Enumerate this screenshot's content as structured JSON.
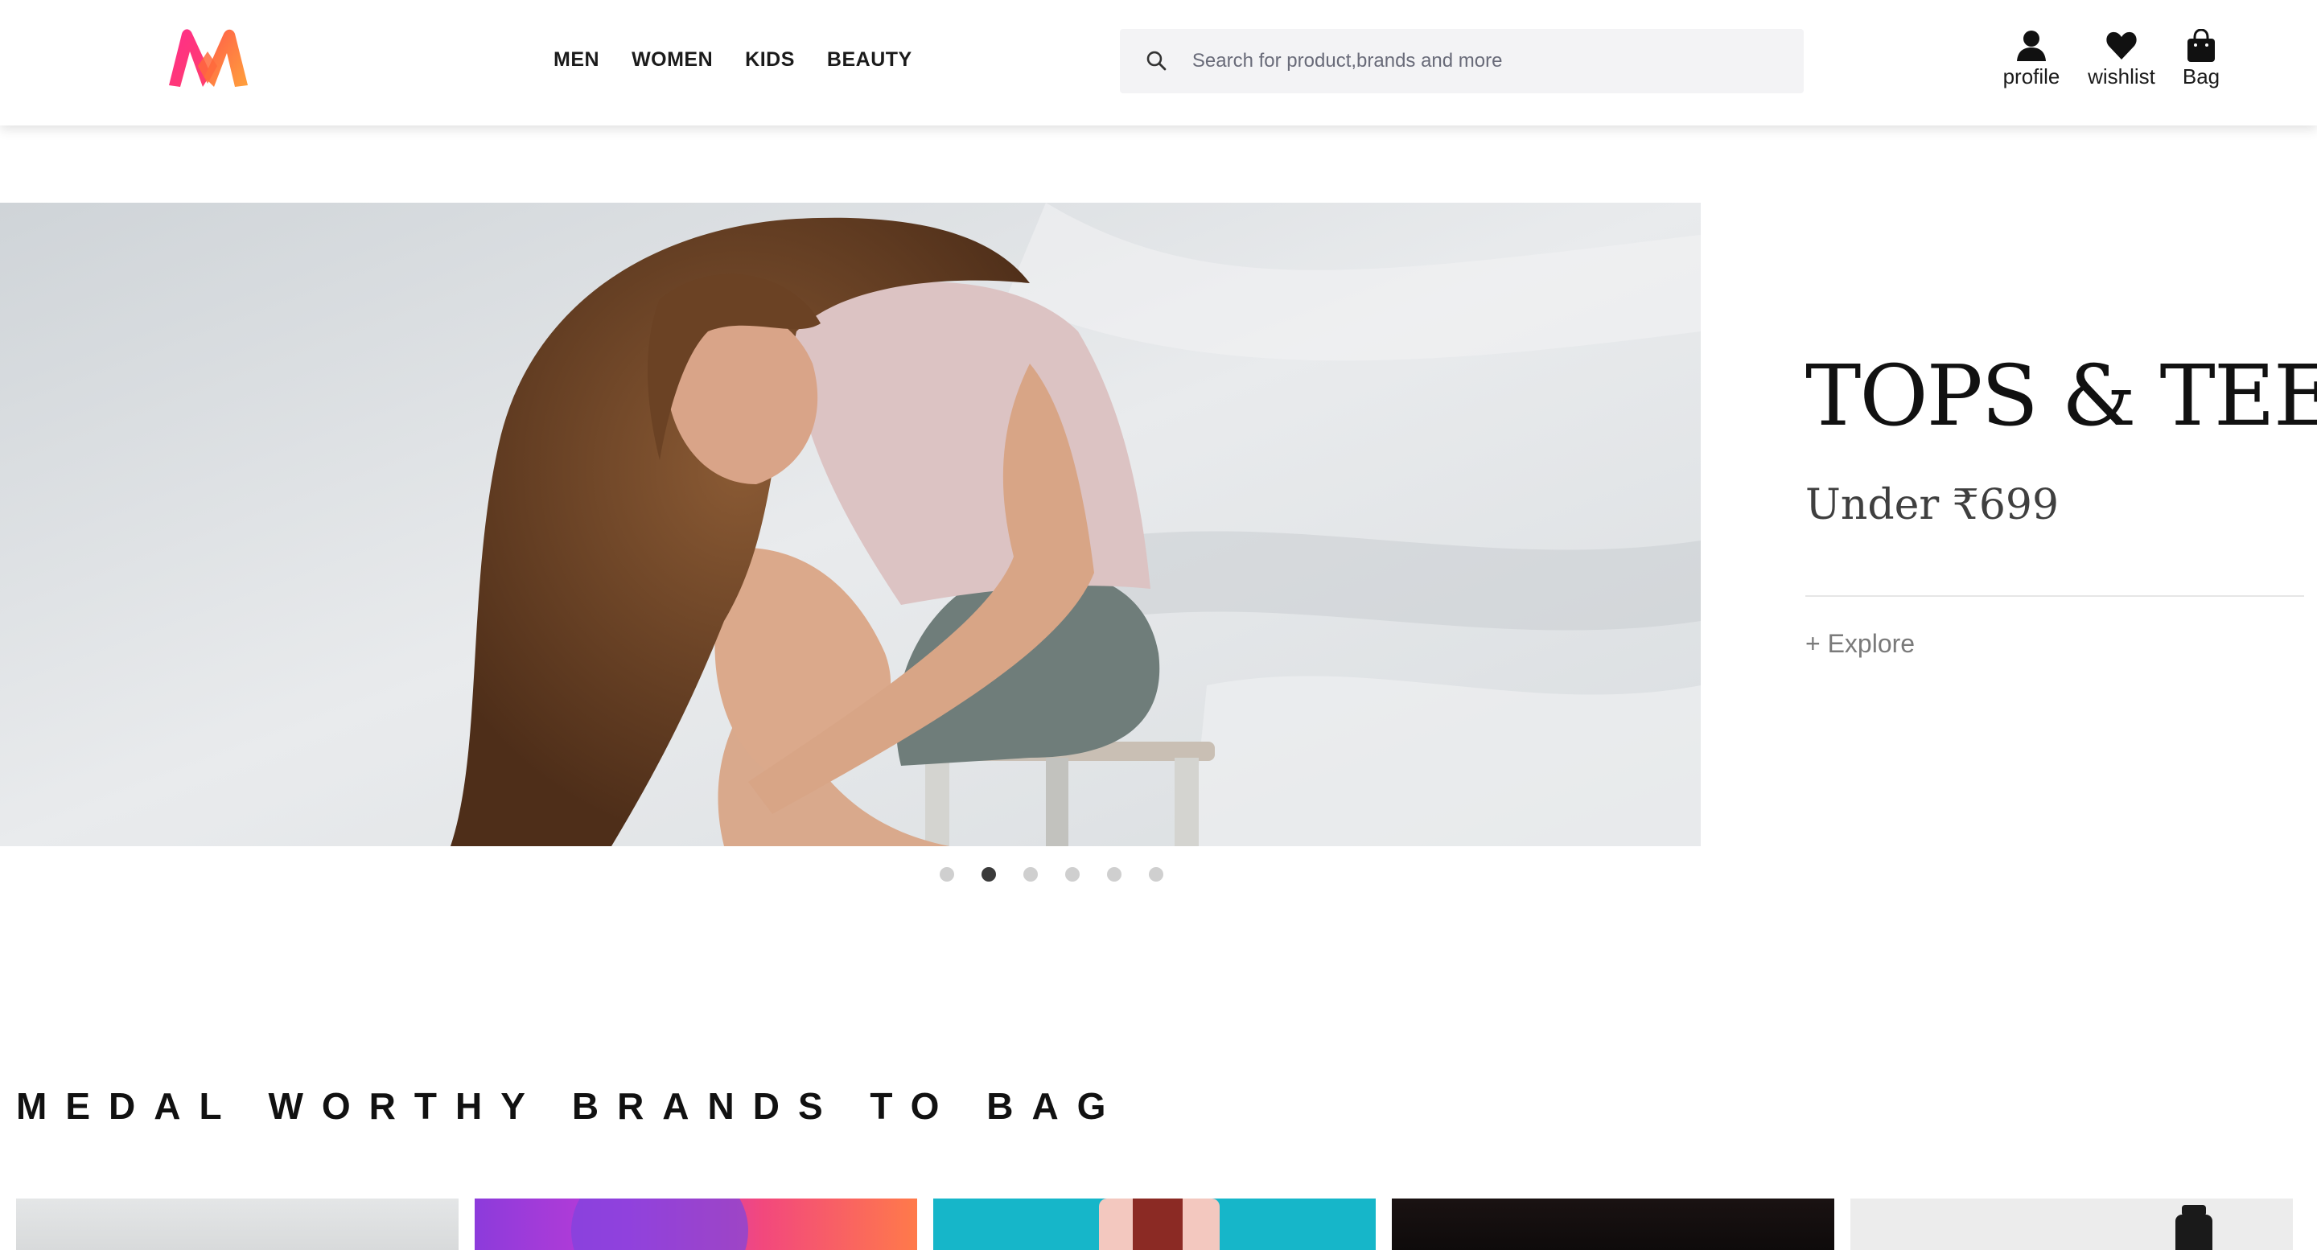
{
  "header": {
    "logo_icon": "myntra-logo-icon",
    "nav": [
      "MEN",
      "WOMEN",
      "KIDS",
      "BEAUTY"
    ],
    "search": {
      "placeholder": "Search for product,brands and more",
      "icon": "search-icon"
    },
    "actions": [
      {
        "label": "profile",
        "icon": "person-icon"
      },
      {
        "label": "wishlist",
        "icon": "heart-icon"
      },
      {
        "label": "Bag",
        "icon": "bag-icon"
      }
    ]
  },
  "hero": {
    "title": "TOPS & TEES",
    "subtitle": "Under ₹699",
    "cta": "+ Explore",
    "slides_count": 6,
    "active_slide": 2
  },
  "brands_section": {
    "heading": "MEDAL WORTHY BRANDS TO BAG",
    "cards": 5
  },
  "colors": {
    "logo_pink": "#ff3f6c",
    "logo_orange": "#ff9a3c",
    "search_bg": "#f3f3f5",
    "dot_active": "#3a3a3a",
    "dot_inactive": "#cfcfcf"
  }
}
